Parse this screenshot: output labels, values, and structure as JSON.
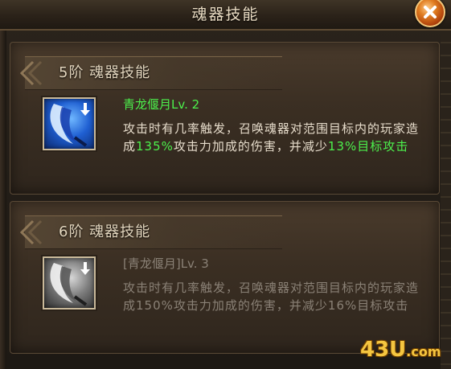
{
  "window": {
    "title": "魂器技能"
  },
  "sections": [
    {
      "header": "5阶  魂器技能",
      "skill_name": "青龙偃月Lv. 2",
      "desc_part1": "攻击时有几率触发，召唤魂器对范围目标内的玩家造成",
      "desc_value1": "135%",
      "desc_part2": "攻击力加成的伤害，并减少",
      "desc_value2": "13%目标攻击",
      "state": "active"
    },
    {
      "header": "6阶  魂器技能",
      "skill_name": "[青龙偃月]Lv. 3",
      "desc_part1": "攻击时有几率触发，召唤魂器对范围目标内的玩家造成",
      "desc_value1": "150%",
      "desc_part2": "攻击力加成的伤害，并减少",
      "desc_value2": "16%目标攻击",
      "state": "locked"
    }
  ],
  "watermark": {
    "main": "43U",
    "suffix": ".com"
  },
  "colors": {
    "highlight": "#4cf04c",
    "title": "#e9dbc2",
    "close": "#e07d20"
  },
  "icons": {
    "close": "close-icon",
    "skill": "crescent-blade-icon",
    "downgrade": "arrow-down-icon"
  }
}
